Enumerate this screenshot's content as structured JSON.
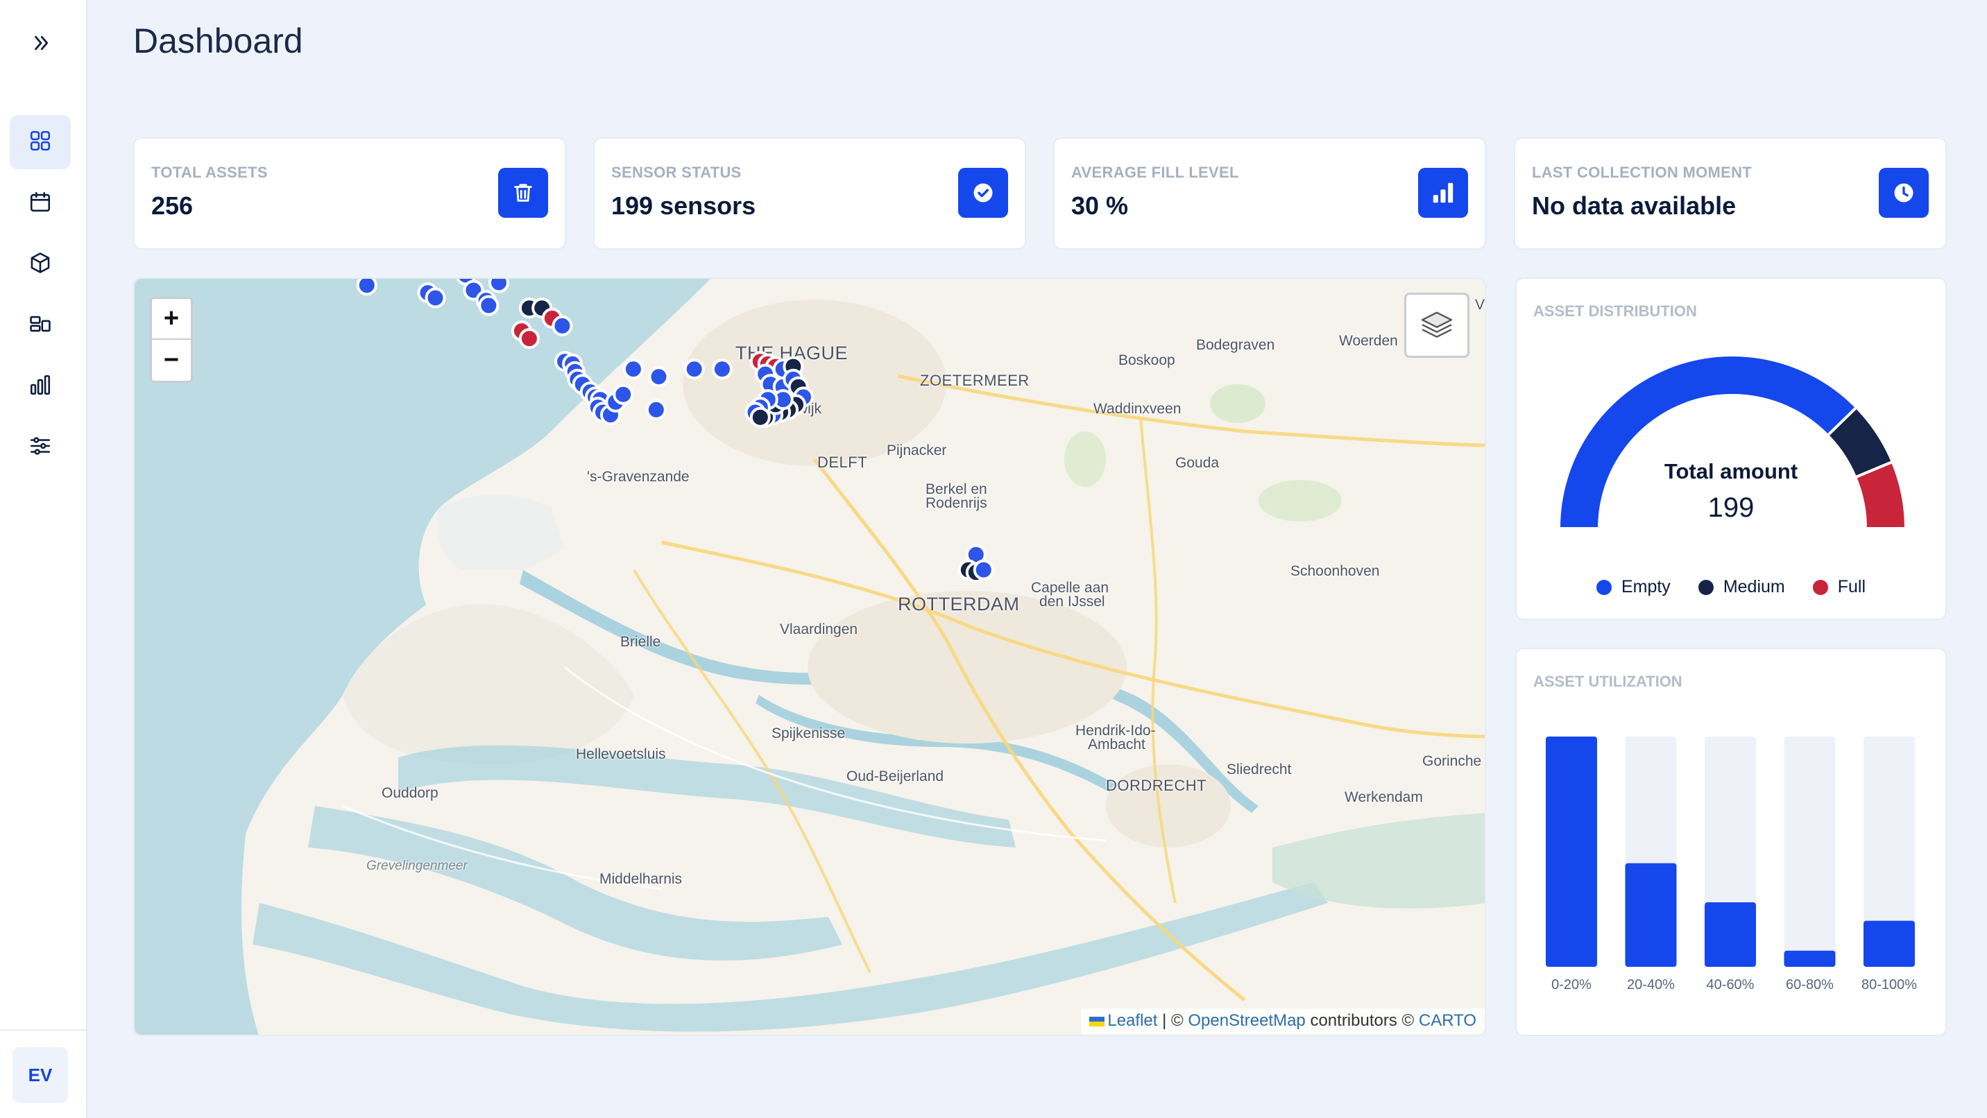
{
  "page": {
    "title": "Dashboard"
  },
  "sidebar": {
    "toggle_icon": "chevron-double-right-icon",
    "items": [
      {
        "icon": "grid-icon",
        "active": true
      },
      {
        "icon": "calendar-icon",
        "active": false
      },
      {
        "icon": "box-icon",
        "active": false
      },
      {
        "icon": "layout-icon",
        "active": false
      },
      {
        "icon": "bar-chart-icon",
        "active": false
      },
      {
        "icon": "sliders-icon",
        "active": false
      }
    ],
    "user_initials": "EV"
  },
  "kpis": [
    {
      "label": "TOTAL ASSETS",
      "value": "256",
      "icon": "trash-icon"
    },
    {
      "label": "SENSOR STATUS",
      "value": "199 sensors",
      "icon": "check-circle-icon"
    },
    {
      "label": "AVERAGE FILL LEVEL",
      "value": "30 %",
      "icon": "bar-chart-icon"
    },
    {
      "label": "LAST COLLECTION MOMENT",
      "value": "No data available",
      "icon": "clock-icon"
    }
  ],
  "map": {
    "zoom_in": "+",
    "zoom_out": "−",
    "layers_icon": "layers-icon",
    "labels": {
      "the_hague": "THE HAGUE",
      "zoetermeer": "ZOETERMEER",
      "rijswijk": "Rijswijk",
      "delft": "DELFT",
      "pijnacker": "Pijnacker",
      "gravenzande": "'s-Gravenzande",
      "berkel": "Berkel en",
      "rodenrijs": "Rodenrijs",
      "rotterdam": "ROTTERDAM",
      "vlaardingen": "Vlaardingen",
      "capelle1": "Capelle aan",
      "capelle2": "den IJssel",
      "brielle": "Brielle",
      "spijkenisse": "Spijkenisse",
      "hellevoetsluis": "Hellevoetsluis",
      "oud_beijerland": "Oud-Beijerland",
      "hendrik1": "Hendrik-Ido-",
      "hendrik2": "Ambacht",
      "sliedrecht": "Sliedrecht",
      "gorinchem": "Gorinche",
      "dordrecht": "DORDRECHT",
      "werkendam": "Werkendam",
      "ouddorp": "Ouddorp",
      "grevelingenmeer": "Grevelingenmeer",
      "middelharnis": "Middelharnis",
      "bodegraven": "Bodegraven",
      "boskoop": "Boskoop",
      "woerden": "Woerden",
      "waddinxveen": "Waddinxveen",
      "gouda": "Gouda",
      "schoonhoven": "Schoonhoven",
      "edge_v": "V"
    },
    "attribution": {
      "leaflet": "Leaflet",
      "sep": " | © ",
      "osm": "OpenStreetMap",
      "contrib": " contributors © ",
      "carto": "CARTO"
    },
    "marker_colors": {
      "empty": "#2d55e8",
      "medium": "#152447",
      "full": "#c8243a"
    }
  },
  "distribution": {
    "title": "ASSET DISTRIBUTION",
    "center_title": "Total amount",
    "total": "199",
    "segments": [
      {
        "name": "Empty",
        "value": 150,
        "color": "#1447ec"
      },
      {
        "name": "Medium",
        "value": 24,
        "color": "#152447"
      },
      {
        "name": "Full",
        "value": 25,
        "color": "#c8243a"
      }
    ]
  },
  "utilization": {
    "title": "ASSET UTILIZATION",
    "chart_data": {
      "type": "bar",
      "categories": [
        "0-20%",
        "20-40%",
        "40-60%",
        "60-80%",
        "80-100%"
      ],
      "values": [
        100,
        45,
        28,
        7,
        20
      ],
      "ylim": [
        0,
        100
      ],
      "bar_color": "#1447ec",
      "track_color": "#eef1f8"
    }
  }
}
